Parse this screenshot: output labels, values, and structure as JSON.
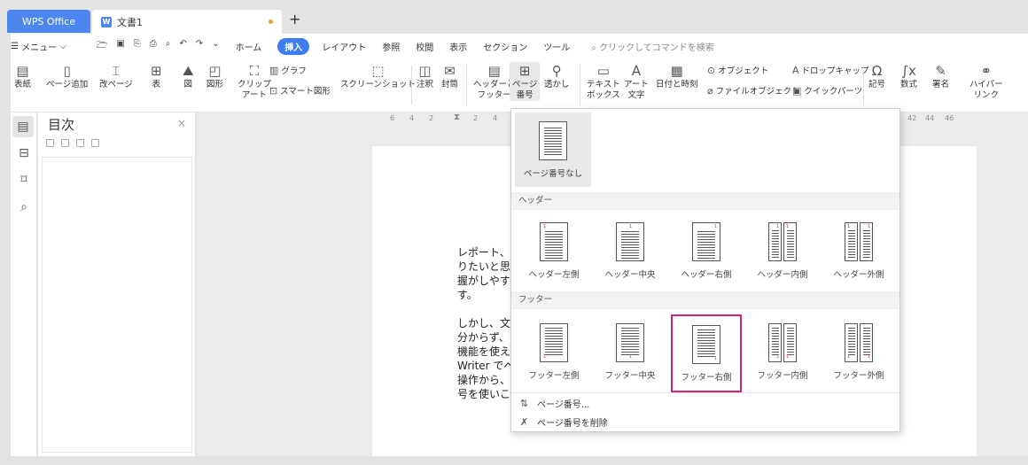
{
  "tabs": {
    "wps": "WPS Office",
    "doc": "文書1",
    "add": "+"
  },
  "menubar": {
    "menu": "メニュー",
    "items": [
      "ホーム",
      "挿入",
      "レイアウト",
      "参照",
      "校閲",
      "表示",
      "セクション",
      "ツール"
    ],
    "active": "挿入",
    "search_placeholder": "クリックしてコマンドを検索"
  },
  "ribbon": {
    "cover": "表紙",
    "page_add": "ページ追加",
    "page_break": "改ページ",
    "table": "表",
    "picture": "図",
    "shape": "図形",
    "clipart_1": "クリップ",
    "clipart_2": "アート",
    "chart": "グラフ",
    "smartart": "スマート図形",
    "screenshot": "スクリーンショット",
    "comment": "注釈",
    "envelope": "封筒",
    "headerfooter_1": "ヘッダーと",
    "headerfooter_2": "フッター",
    "pagenum_1": "ページ",
    "pagenum_2": "番号",
    "watermark": "透かし",
    "textbox_1": "テキスト",
    "textbox_2": "ボックス",
    "art_1": "アート",
    "art_2": "文字",
    "datetime": "日付と時刻",
    "object": "オブジェクト",
    "fileobject": "ファイルオブジェクト",
    "dropcap": "ドロップキャップ",
    "quickparts": "クイックパーツ",
    "symbol": "記号",
    "formula": "数式",
    "signature": "署名",
    "hyperlink_1": "ハイパー",
    "hyperlink_2": "リンク"
  },
  "toc": {
    "title": "目次",
    "close": "×"
  },
  "ruler": [
    "6",
    "4",
    "2",
    "2",
    "4",
    "42",
    "44",
    "46"
  ],
  "document": {
    "lines": [
      "レポート、",
      "りたいと思",
      "握がしやす",
      "す。",
      "しかし、文",
      "分からず、",
      "機能を使え",
      "Writer でペ",
      "操作から、",
      "号を使いこ"
    ]
  },
  "dropdown": {
    "none_label": "ページ番号なし",
    "header_section": "ヘッダー",
    "footer_section": "フッター",
    "header_opts": [
      "ヘッダー左側",
      "ヘッダー中央",
      "ヘッダー右側",
      "ヘッダー内側",
      "ヘッダー外側"
    ],
    "footer_opts": [
      "フッター左側",
      "フッター中央",
      "フッター右側",
      "フッター内側",
      "フッター外側"
    ],
    "menu_pagenum": "ページ番号...",
    "menu_delete": "ページ番号を削除",
    "page_digit": "1",
    "selected_color": "#d4237a"
  }
}
